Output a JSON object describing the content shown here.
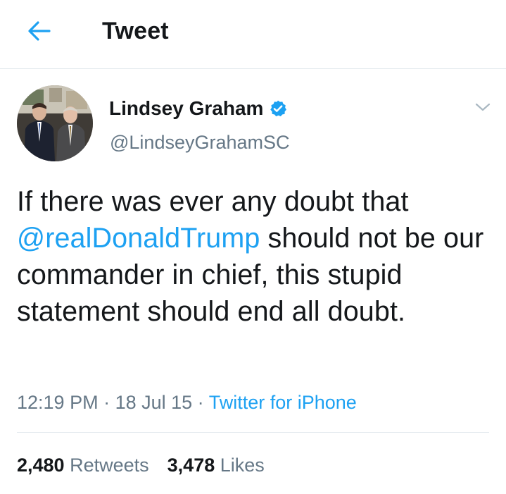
{
  "header": {
    "title": "Tweet",
    "back_icon": "arrow-left-icon"
  },
  "colors": {
    "accent": "#1da1f2",
    "text": "#14171a",
    "secondary_text": "#657786",
    "divider": "#e1e8ed"
  },
  "tweet": {
    "author": {
      "name": "Lindsey Graham",
      "handle": "@LindseyGrahamSC",
      "verified": true
    },
    "text_parts": {
      "before": "If there was ever any doubt that ",
      "mention": "@realDonaldTrump",
      "after": " should not be our commander in chief, this stupid statement should end all doubt."
    },
    "time": "12:19 PM",
    "date": "18 Jul 15",
    "separator": " · ",
    "source": "Twitter for iPhone",
    "stats": {
      "retweets_count": "2,480",
      "retweets_label": "Retweets",
      "likes_count": "3,478",
      "likes_label": "Likes"
    }
  }
}
